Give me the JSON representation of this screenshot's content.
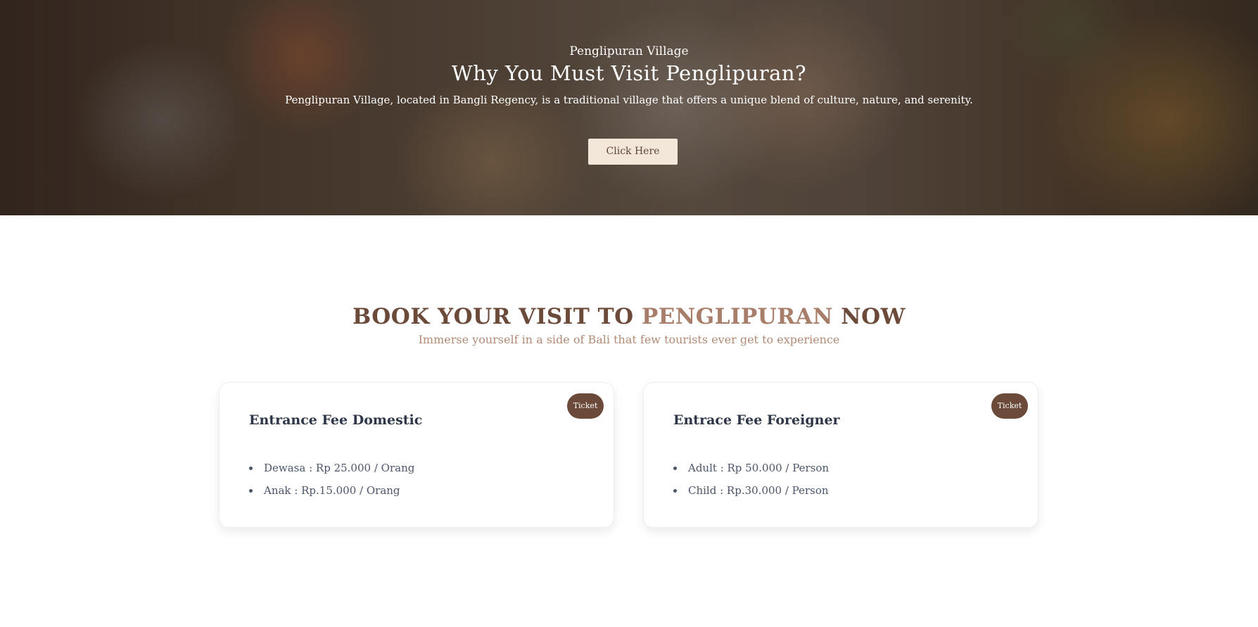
{
  "hero": {
    "eyebrow": "Penglipuran Village",
    "title": "Why You Must Visit Penglipuran?",
    "description": "Penglipuran Village, located in Bangli Regency, is a traditional village that offers a unique blend of culture, nature, and serenity.",
    "button_label": "Click Here"
  },
  "booking": {
    "heading_part1": "BOOK YOUR VISIT TO",
    "heading_accent": "PENGLIPURAN",
    "heading_part2": "NOW",
    "subtitle": "Immerse yourself in a side of Bali that few tourists ever get to experience"
  },
  "cards": [
    {
      "title": "Entrance Fee Domestic",
      "badge": "Ticket",
      "items": [
        "Dewasa : Rp 25.000 / Orang",
        "Anak : Rp.15.000 / Orang"
      ]
    },
    {
      "title": "Entrace Fee Foreigner",
      "badge": "Ticket",
      "items": [
        "Adult : Rp 50.000 / Person",
        "Child : Rp.30.000 / Person"
      ]
    }
  ],
  "colors": {
    "brand_brown": "#6b4a3a",
    "accent_tan": "#a87e6a",
    "button_cream": "#f3e7da"
  }
}
